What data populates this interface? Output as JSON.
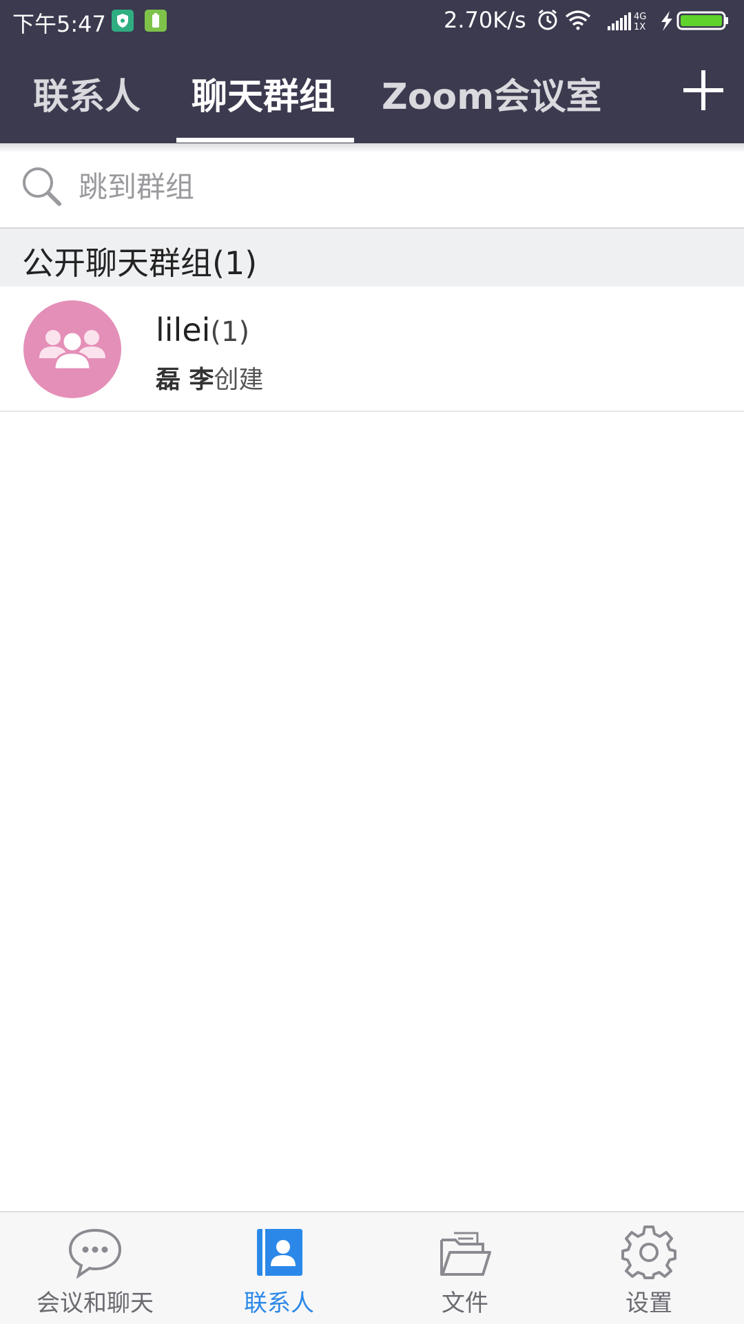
{
  "status_bar": {
    "time": "下午5:47",
    "network_speed": "2.70K/s",
    "network_type": "4G 1X"
  },
  "top_nav": {
    "tabs": [
      {
        "label": "联系人"
      },
      {
        "label": "聊天群组"
      },
      {
        "label": "Zoom会议室"
      }
    ],
    "active_tab": "聊天群组",
    "add_icon": "plus-icon"
  },
  "search": {
    "placeholder": "跳到群组",
    "value": ""
  },
  "section": {
    "title": "公开聊天群组(1)"
  },
  "groups": [
    {
      "name": "lilei",
      "count": "(1)",
      "creator": "磊 李",
      "created_suffix": "创建",
      "avatar_color": "#e48fb8"
    }
  ],
  "bottom_nav": {
    "items": [
      {
        "label": "会议和聊天",
        "icon": "chat-bubble-icon"
      },
      {
        "label": "联系人",
        "icon": "contacts-icon"
      },
      {
        "label": "文件",
        "icon": "folder-icon"
      },
      {
        "label": "设置",
        "icon": "gear-icon"
      }
    ],
    "active": "联系人"
  },
  "colors": {
    "header_bg": "#3b3a4f",
    "accent": "#2b88e8",
    "section_bg": "#eff0f2"
  }
}
